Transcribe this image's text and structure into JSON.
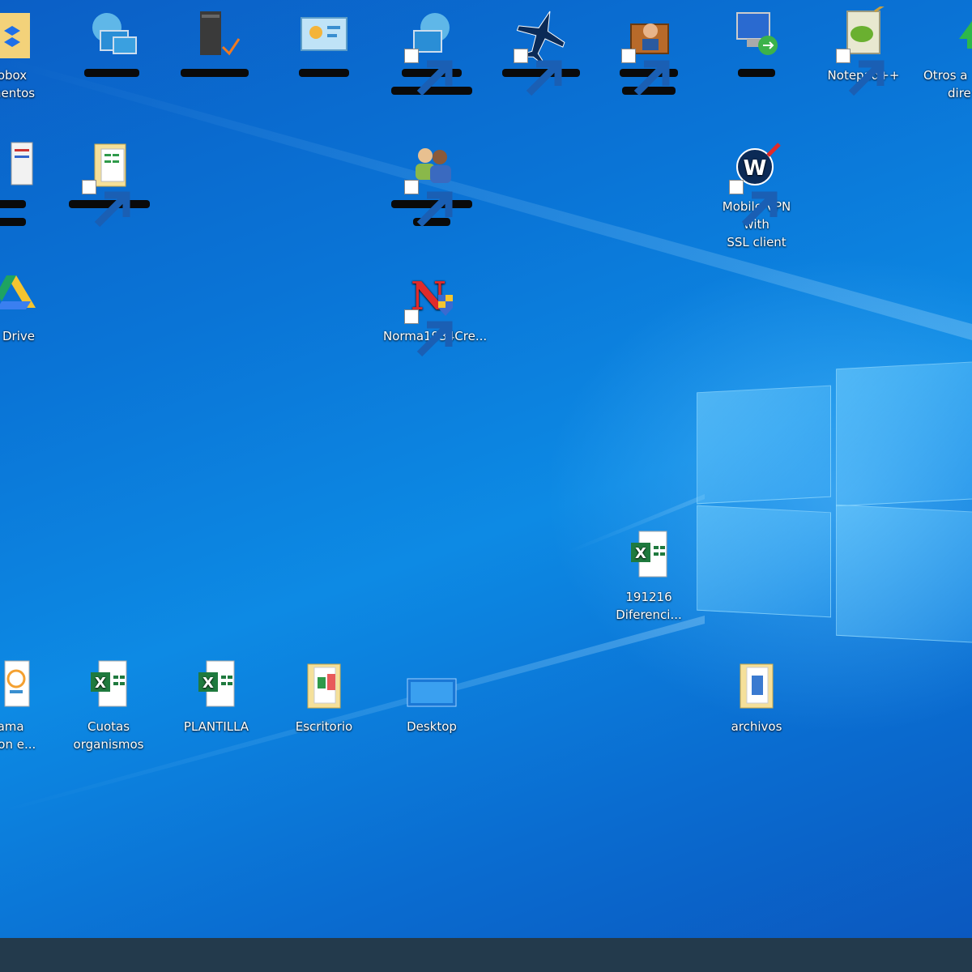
{
  "desktop": {
    "icons": [
      {
        "id": "dropbox",
        "line1": "obox",
        "line2": "mentos"
      },
      {
        "id": "network",
        "line1": "",
        "line2": ""
      },
      {
        "id": "server",
        "line1": "",
        "line2": ""
      },
      {
        "id": "control",
        "line1": "",
        "line2": ""
      },
      {
        "id": "remote-globe",
        "line1": "",
        "line2": ""
      },
      {
        "id": "plane",
        "line1": "",
        "line2": ""
      },
      {
        "id": "briefcase",
        "line1": "",
        "line2": ""
      },
      {
        "id": "remote-desktop",
        "line1": "",
        "line2": ""
      },
      {
        "id": "notepadpp",
        "line1": "Notepad++",
        "line2": ""
      },
      {
        "id": "otros",
        "line1": "Otros a",
        "line2": "dire"
      },
      {
        "id": "docs",
        "line1": "",
        "line2": ""
      },
      {
        "id": "folder-sheet",
        "line1": "",
        "line2": ""
      },
      {
        "id": "users",
        "line1": "",
        "line2": ""
      },
      {
        "id": "vpn",
        "line1": "Mobile VPN with",
        "line2": "SSL client"
      },
      {
        "id": "gdrive",
        "line1": "e Drive",
        "line2": ""
      },
      {
        "id": "norma",
        "line1": "Norma1934Cre...",
        "line2": ""
      },
      {
        "id": "xls-191216",
        "line1": "191216",
        "line2": "Diferenci..."
      },
      {
        "id": "programa",
        "line1": "rama",
        "line2": "acion e..."
      },
      {
        "id": "cuotas",
        "line1": "Cuotas",
        "line2": "organismos"
      },
      {
        "id": "plantilla",
        "line1": "PLANTILLA",
        "line2": ""
      },
      {
        "id": "escritorio",
        "line1": "Escritorio",
        "line2": ""
      },
      {
        "id": "desktop-folder",
        "line1": "Desktop",
        "line2": ""
      },
      {
        "id": "archivos",
        "line1": "archivos",
        "line2": ""
      }
    ]
  },
  "colors": {
    "accent": "#0a74d6",
    "taskbar": "#233a4c"
  }
}
